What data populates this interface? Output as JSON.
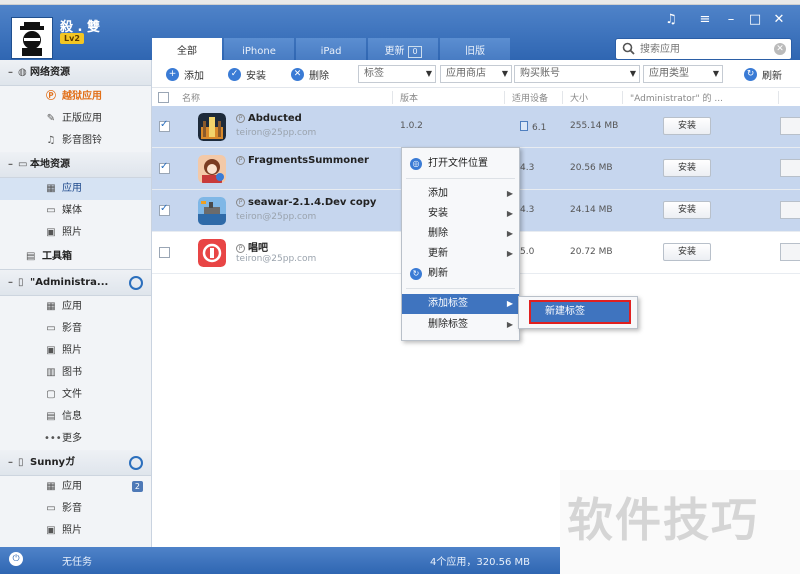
{
  "app": {
    "username": "殺 . 雙",
    "level": "Lv2",
    "tabs": [
      {
        "label": "全部",
        "active": true
      },
      {
        "label": "iPhone",
        "active": false
      },
      {
        "label": "iPad",
        "active": false
      },
      {
        "label": "更新",
        "badge": "0",
        "active": false
      },
      {
        "label": "旧版",
        "active": false
      }
    ],
    "search_placeholder": "搜索应用"
  },
  "sidebar": {
    "network": {
      "title": "网络资源",
      "items": [
        "越狱应用",
        "正版应用",
        "影音图铃"
      ]
    },
    "local": {
      "title": "本地资源",
      "items": [
        "应用",
        "媒体",
        "照片"
      ]
    },
    "toolbox": "工具箱",
    "device1": {
      "title": "\"Administra...",
      "items": [
        "应用",
        "影音",
        "照片",
        "图书",
        "文件",
        "信息",
        "更多"
      ]
    },
    "device2": {
      "title": "Sunnyガ",
      "items": [
        {
          "label": "应用",
          "count": "2"
        },
        {
          "label": "影音"
        },
        {
          "label": "照片"
        }
      ]
    }
  },
  "toolbar": {
    "add": "添加",
    "install": "安装",
    "delete": "删除",
    "tag_filter": "标签",
    "store_filter": "应用商店",
    "account_filter": "购买账号",
    "type_filter": "应用类型",
    "refresh": "刷新"
  },
  "table": {
    "headers": [
      "名称",
      "版本",
      "适用设备",
      "大小",
      "\"Administrator\" 的 ..."
    ],
    "rows": [
      {
        "name": "Abducted",
        "sub": "teiron@25pp.com",
        "version": "1.0.2",
        "device": "6.1",
        "size": "255.14 MB",
        "action": "安装",
        "selected": true
      },
      {
        "name": "FragmentsSummoner",
        "sub": "",
        "version": "",
        "device": "4.3",
        "size": "20.56 MB",
        "action": "安装",
        "selected": true
      },
      {
        "name": "seawar-2.1.4.Dev copy",
        "sub": "teiron@25pp.com",
        "version": "",
        "device": "4.3",
        "size": "24.14 MB",
        "action": "安装",
        "selected": true
      },
      {
        "name": "唱吧",
        "sub": "teiron@25pp.com",
        "version": "",
        "device": "5.0",
        "size": "20.72 MB",
        "action": "安装",
        "selected": false
      }
    ]
  },
  "context_menu": {
    "items": [
      "打开文件位置",
      "添加",
      "安装",
      "删除",
      "更新",
      "刷新",
      "添加标签",
      "删除标签"
    ],
    "submenu_item": "新建标签"
  },
  "status": {
    "task": "无任务",
    "summary": "4个应用，320.56 MB"
  },
  "watermark": "软件技巧",
  "colors": {
    "header": "#3a70bb",
    "selection": "#c6d6ee",
    "menu_highlight": "#3f74bf",
    "callout": "#e02020"
  }
}
